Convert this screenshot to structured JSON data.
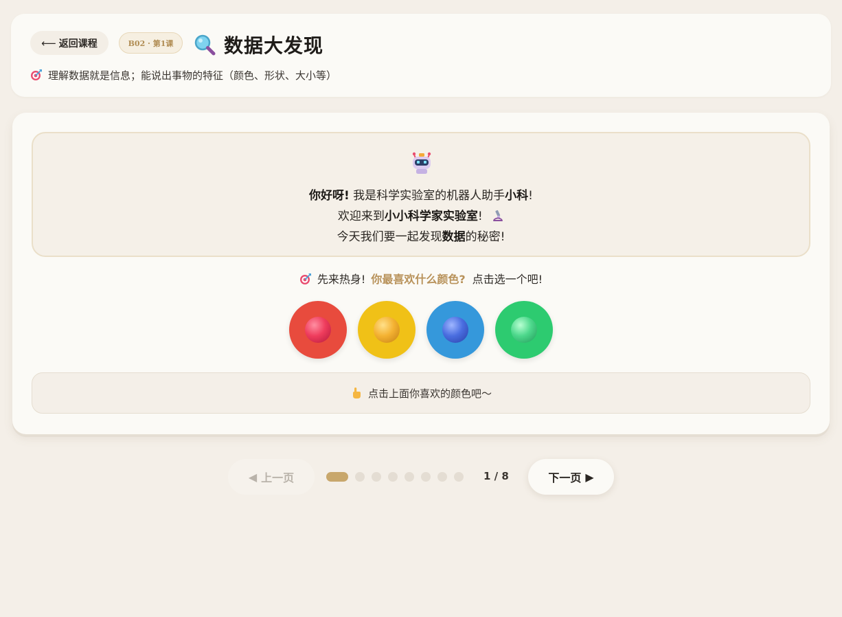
{
  "header": {
    "back_label": "返回课程",
    "back_arrow": "⟵",
    "lesson_badge": "B02 · 第1课",
    "title": "数据大发现",
    "title_icon": "magnifier-icon",
    "objective_icon": "target-icon",
    "objective": "理解数据就是信息；能说出事物的特征（颜色、形状、大小等）"
  },
  "intro": {
    "robot_icon": "robot-icon",
    "line1_bold": "你好呀!",
    "line1_text": " 我是科学实验室的机器人助手",
    "line1_name": "小科",
    "line1_end": "!",
    "line2_text": "欢迎来到",
    "line2_bold": "小小科学家实验室",
    "line2_end": "!",
    "line2_icon": "microscope-icon",
    "line3_text": "今天我们要一起发现",
    "line3_bold": "数据",
    "line3_end": "的秘密!"
  },
  "question": {
    "icon": "target-icon",
    "lead": "先来热身!",
    "highlight": "你最喜欢什么颜色?",
    "tail": "点击选一个吧!"
  },
  "color_options": [
    {
      "name": "red",
      "color": "#e84b3d"
    },
    {
      "name": "yellow",
      "color": "#f0c117"
    },
    {
      "name": "blue",
      "color": "#3598db"
    },
    {
      "name": "green",
      "color": "#2dcb70"
    }
  ],
  "hint": {
    "icon": "pointing-hand-icon",
    "text": "点击上面你喜欢的颜色吧～"
  },
  "pagination": {
    "prev_label": "上一页",
    "next_label": "下一页",
    "prev_disabled": true,
    "current_page": 1,
    "total_pages": 8,
    "counter": "1 / 8"
  },
  "colors": {
    "background": "#f4efe8",
    "card": "#fbfaf6",
    "accent": "#c8a76c",
    "highlight_text": "#b8925a"
  }
}
